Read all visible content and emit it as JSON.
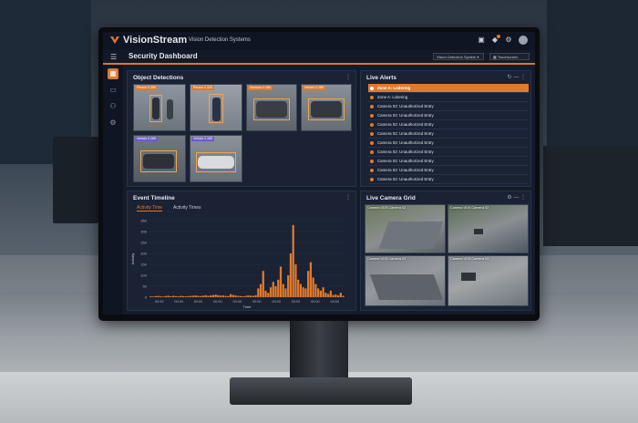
{
  "app": {
    "brand": "VisionStream",
    "subtitle": "Vision Detection Systems",
    "page_title": "Security Dashboard",
    "system_select": "Vision Detection System",
    "theme_button": "Touchscreen",
    "accent_color": "#e07a2c"
  },
  "panels": {
    "detections_title": "Object Detections",
    "alerts_title": "Live Alerts",
    "timeline_title": "Event Timeline",
    "camera_grid_title": "Live Camera Grid"
  },
  "detections": [
    {
      "label": "Person 0.285",
      "kind": "person"
    },
    {
      "label": "Person 0.320",
      "kind": "person"
    },
    {
      "label": "Decision 0.286",
      "kind": "car"
    },
    {
      "label": "Vehicle 0.285",
      "kind": "car"
    },
    {
      "label": "Vehicle 0.285",
      "kind": "car"
    },
    {
      "label": "Vehicle 0.285",
      "kind": "car"
    }
  ],
  "alerts": [
    {
      "text": "Zone A: Loitering",
      "active": true
    },
    {
      "text": "Zone A: Loitering",
      "active": false
    },
    {
      "text": "Camera 02: Unauthorized Entry",
      "active": false
    },
    {
      "text": "Camera 02: Unauthorized Entry",
      "active": false
    },
    {
      "text": "Camera 02: Unauthorized Entry",
      "active": false
    },
    {
      "text": "Camera 02: Unauthorized Entry",
      "active": false
    },
    {
      "text": "Camera 02: Unauthorized Entry",
      "active": false
    },
    {
      "text": "Camera 02: Unauthorized Entry",
      "active": false
    },
    {
      "text": "Camera 02: Unauthorized Entry",
      "active": false
    },
    {
      "text": "Camera 02: Unauthorized Entry",
      "active": false
    },
    {
      "text": "Camera 02: Unauthorized Entry",
      "active": false
    }
  ],
  "timeline": {
    "tabs": [
      "Activity Time",
      "Activity Times"
    ]
  },
  "cameras": [
    {
      "label": "Camera VDS Camera 02"
    },
    {
      "label": "Camera VDS Camera 03"
    },
    {
      "label": "Camera VDS Camera 03"
    },
    {
      "label": "Camera VDS Camera 03"
    }
  ],
  "chart_data": {
    "type": "bar",
    "xlabel": "Time",
    "ylabel": "Activity",
    "ylim": [
      0,
      350
    ],
    "yticks": [
      0,
      50,
      100,
      150,
      200,
      250,
      300,
      350
    ],
    "xticks": [
      "00:00",
      "00:00",
      "00:00",
      "00:00",
      "00:00",
      "00:00",
      "00:00",
      "00:00",
      "00:00",
      "00:00"
    ],
    "values": [
      4,
      3,
      5,
      6,
      4,
      3,
      5,
      7,
      4,
      6,
      5,
      4,
      6,
      5,
      4,
      5,
      6,
      7,
      8,
      6,
      5,
      7,
      9,
      6,
      8,
      10,
      12,
      9,
      7,
      8,
      6,
      5,
      14,
      10,
      8,
      6,
      5,
      4,
      6,
      8,
      7,
      6,
      9,
      40,
      60,
      120,
      30,
      20,
      45,
      70,
      50,
      80,
      140,
      60,
      40,
      100,
      200,
      330,
      150,
      80,
      60,
      45,
      40,
      120,
      160,
      90,
      60,
      40,
      30,
      45,
      20,
      15,
      30,
      10,
      12,
      8,
      20,
      6
    ]
  }
}
